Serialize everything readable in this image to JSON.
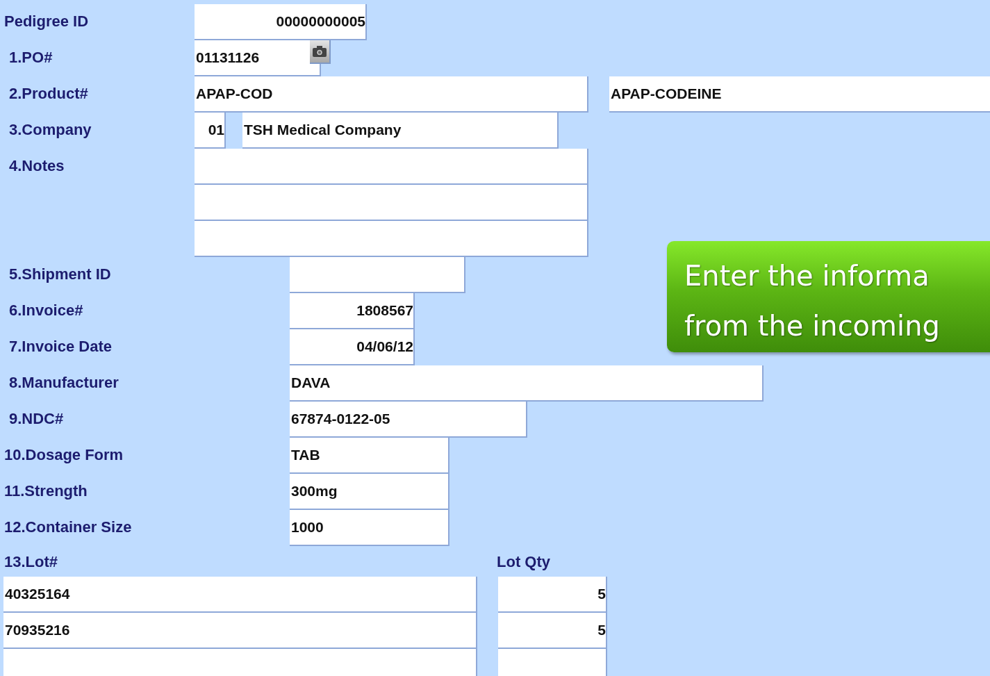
{
  "form": {
    "fields": [
      {
        "label": "Pedigree ID",
        "values": [
          "00000000005"
        ]
      },
      {
        "label": "1.PO#",
        "values": [
          "01131126"
        ]
      },
      {
        "label": "2.Product#",
        "values": [
          "APAP-COD",
          "APAP-CODEINE"
        ]
      },
      {
        "label": "3.Company",
        "values": [
          "01",
          "TSH Medical Company"
        ]
      },
      {
        "label": "4.Notes"
      },
      {
        "label": "5.Shipment ID"
      },
      {
        "label": "6.Invoice#",
        "values": [
          "1808567"
        ]
      },
      {
        "label": "7.Invoice Date",
        "values": [
          "04/06/12"
        ]
      },
      {
        "label": "8.Manufacturer",
        "values": [
          "DAVA"
        ]
      },
      {
        "label": "9.NDC#",
        "values": [
          "67874-0122-05"
        ]
      },
      {
        "label": "10.Dosage Form",
        "values": [
          "TAB"
        ]
      },
      {
        "label": "11.Strength",
        "values": [
          "300mg"
        ]
      },
      {
        "label": "12.Container Size",
        "values": [
          "1000"
        ]
      }
    ],
    "lot_header": "13.Lot#",
    "qty_header": "Lot Qty",
    "lots": [
      {
        "lot": "40325164",
        "qty": "5"
      },
      {
        "lot": "70935216",
        "qty": "5"
      }
    ]
  },
  "callout": {
    "lines": [
      "Enter the informa",
      "from the incoming"
    ]
  }
}
